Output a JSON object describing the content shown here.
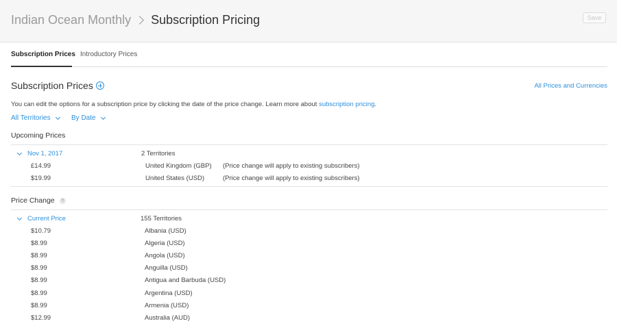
{
  "header": {
    "breadcrumb_parent": "Indian Ocean Monthly",
    "breadcrumb_current": "Subscription Pricing",
    "save_label": "Save"
  },
  "tabs": [
    {
      "label": "Subscription Prices",
      "active": true
    },
    {
      "label": "Introductory Prices",
      "active": false
    }
  ],
  "section": {
    "title": "Subscription Prices",
    "all_prices_link": "All Prices and Currencies",
    "description_text": "You can edit the options for a subscription price by clicking the date of the price change. Learn more about ",
    "description_link": "subscription pricing",
    "description_end": "."
  },
  "filters": {
    "territories": "All Territories",
    "sort": "By Date"
  },
  "upcoming": {
    "title": "Upcoming Prices",
    "date": "Nov 1, 2017",
    "count": "2 Territories",
    "rows": [
      {
        "price": "£14.99",
        "territory": "United Kingdom (GBP)",
        "note": "(Price change will apply to existing subscribers)"
      },
      {
        "price": "$19.99",
        "territory": "United States (USD)",
        "note": "(Price change will apply to existing subscribers)"
      }
    ]
  },
  "price_change": {
    "title": "Price Change",
    "help_glyph": "?",
    "current_label": "Current Price",
    "count": "155 Territories",
    "rows": [
      {
        "price": "$10.79",
        "territory": "Albania (USD)"
      },
      {
        "price": "$8.99",
        "territory": "Algeria (USD)"
      },
      {
        "price": "$8.99",
        "territory": "Angola (USD)"
      },
      {
        "price": "$8.99",
        "territory": "Anguilla (USD)"
      },
      {
        "price": "$8.99",
        "territory": "Antigua and Barbuda (USD)"
      },
      {
        "price": "$8.99",
        "territory": "Argentina (USD)"
      },
      {
        "price": "$8.99",
        "territory": "Armenia (USD)"
      },
      {
        "price": "$12.99",
        "territory": "Australia (AUD)"
      }
    ]
  },
  "colors": {
    "accent": "#2d8fdb",
    "header_bg": "#f6f6f6"
  },
  "icons": {
    "breadcrumb_separator": "chevron-right-icon",
    "add": "plus-circle-icon",
    "dropdown": "chevron-down-icon",
    "help": "question-icon"
  }
}
